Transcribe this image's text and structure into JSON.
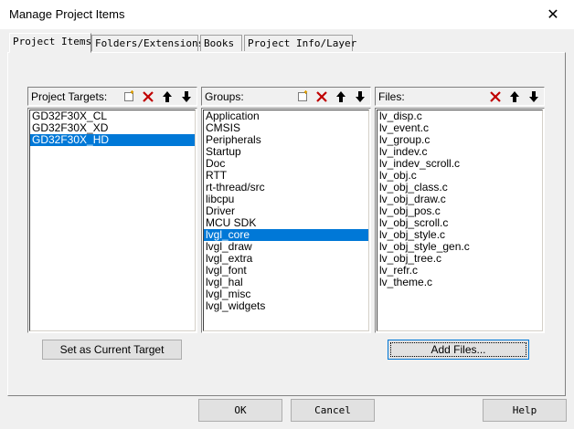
{
  "window": {
    "title": "Manage Project Items",
    "close_glyph": "✕"
  },
  "tabs": [
    {
      "label": "Project Items"
    },
    {
      "label": "Folders/Extensions"
    },
    {
      "label": "Books"
    },
    {
      "label": "Project Info/Layer"
    }
  ],
  "targets": {
    "label": "Project Targets:",
    "items": [
      "GD32F30X_CL",
      "GD32F30X_XD",
      "GD32F30X_HD"
    ],
    "selected_index": 2
  },
  "groups": {
    "label": "Groups:",
    "items": [
      "Application",
      "CMSIS",
      "Peripherals",
      "Startup",
      "Doc",
      "RTT",
      "rt-thread/src",
      "libcpu",
      "Driver",
      "MCU SDK",
      "lvgl_core",
      "lvgl_draw",
      "lvgl_extra",
      "lvgl_font",
      "lvgl_hal",
      "lvgl_misc",
      "lvgl_widgets"
    ],
    "selected_index": 10
  },
  "files": {
    "label": "Files:",
    "items": [
      "lv_disp.c",
      "lv_event.c",
      "lv_group.c",
      "lv_indev.c",
      "lv_indev_scroll.c",
      "lv_obj.c",
      "lv_obj_class.c",
      "lv_obj_draw.c",
      "lv_obj_pos.c",
      "lv_obj_scroll.c",
      "lv_obj_style.c",
      "lv_obj_style_gen.c",
      "lv_obj_tree.c",
      "lv_refr.c",
      "lv_theme.c"
    ]
  },
  "buttons": {
    "set_current_target": "Set as Current Target",
    "add_files": "Add Files...",
    "ok": "OK",
    "cancel": "Cancel",
    "help": "Help"
  },
  "icons": {
    "new": "new-icon",
    "delete": "delete-icon",
    "up": "arrow-up-icon",
    "down": "arrow-down-icon"
  },
  "colors": {
    "selection": "#0078d7",
    "delete_red": "#c00000"
  }
}
